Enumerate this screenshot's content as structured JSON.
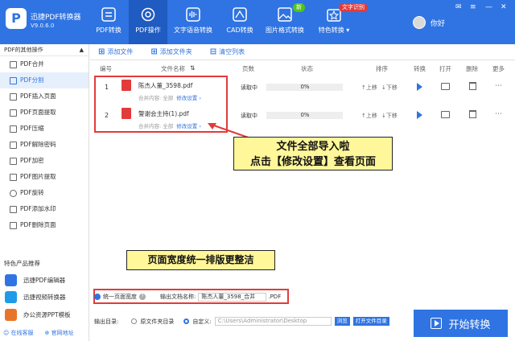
{
  "app": {
    "name": "迅捷PDF转换器",
    "version": "V9.0.6.0",
    "logo_letter": "P"
  },
  "nav": [
    {
      "label": "PDF转换",
      "icon": "convert-icon"
    },
    {
      "label": "PDF操作",
      "icon": "pdf-operate-icon"
    },
    {
      "label": "文字语音转换",
      "icon": "voice-icon"
    },
    {
      "label": "CAD转换",
      "icon": "cad-icon"
    },
    {
      "label": "图片格式转换",
      "icon": "image-icon"
    },
    {
      "label": "特色转换",
      "icon": "special-icon"
    }
  ],
  "badges": {
    "new": "新",
    "ocr": "文字识别"
  },
  "user": {
    "name": "你好"
  },
  "sidebar": {
    "title": "PDF的其他操作",
    "items": [
      "PDF合并",
      "PDF分割",
      "PDF插入页面",
      "PDF页面提取",
      "PDF压缩",
      "PDF解除密码",
      "PDF加密",
      "PDF图片提取",
      "PDF旋转",
      "PDF添加水印",
      "PDF删除页面"
    ],
    "products_title": "特色产品推荐",
    "products": [
      "迅捷PDF编辑器",
      "迅捷视频转换器",
      "办公资源PPT模板"
    ],
    "footer": [
      "在线客服",
      "官网地址"
    ]
  },
  "toolbar": {
    "add_file": "添加文件",
    "add_folder": "添加文件夹",
    "clear": "清空列表"
  },
  "columns": {
    "num": "编号",
    "name": "文件名称",
    "pages": "页数",
    "status": "状态",
    "sort": "排序",
    "convert": "转换",
    "open": "打开",
    "delete": "删除",
    "more": "更多"
  },
  "rows": [
    {
      "num": "1",
      "name": "陈杰人董_3598.pdf",
      "merge_label": "合并内容: 全部",
      "edit": "修改设置",
      "pages": "读取中",
      "progress": "0%",
      "up": "上移",
      "down": "下移"
    },
    {
      "num": "2",
      "name": "警谢会主持(1).pdf",
      "merge_label": "合并内容: 全部",
      "edit": "修改设置",
      "pages": "读取中",
      "progress": "0%",
      "up": "上移",
      "down": "下移"
    }
  ],
  "callout1": {
    "line1": "文件全部导入啦",
    "line2": "点击【修改设置】查看页面"
  },
  "callout2": "页面宽度统一排版更整洁",
  "bottom": {
    "unify_label": "统一页面宽度",
    "output_name_label": "输出文档名称:",
    "output_name": "陈杰人董_3598_合并",
    "ext": ".PDF",
    "output_dir_label": "输出目录:",
    "opt_original": "原文件夹目录",
    "opt_custom": "自定义:",
    "path": "C:\\Users\\Administrator\\Desktop",
    "browse": "浏览",
    "open_folder": "打开文件目录",
    "start": "开始转换"
  },
  "colors": {
    "primary": "#2f74e2",
    "red": "#e23b3b",
    "callout": "#fff799"
  }
}
